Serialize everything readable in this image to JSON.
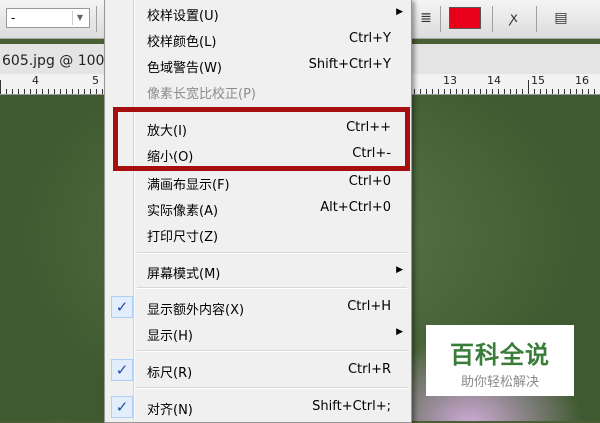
{
  "toolbar": {
    "select_value": "-",
    "swatch_color": "#e8001a"
  },
  "document": {
    "tab_label": "605.jpg @ 100"
  },
  "ruler": {
    "numbers": [
      "4",
      "5",
      "13",
      "14",
      "15",
      "16"
    ]
  },
  "menu": {
    "items": [
      {
        "label": "校样设置(U)",
        "shortcut": "",
        "submenu": true
      },
      {
        "label": "校样颜色(L)",
        "shortcut": "Ctrl+Y"
      },
      {
        "label": "色域警告(W)",
        "shortcut": "Shift+Ctrl+Y"
      },
      {
        "label": "像素长宽比校正(P)",
        "shortcut": "",
        "disabled": true
      },
      {
        "label": "放大(I)",
        "shortcut": "Ctrl++"
      },
      {
        "label": "缩小(O)",
        "shortcut": "Ctrl+-"
      },
      {
        "label": "满画布显示(F)",
        "shortcut": "Ctrl+0"
      },
      {
        "label": "实际像素(A)",
        "shortcut": "Alt+Ctrl+0"
      },
      {
        "label": "打印尺寸(Z)",
        "shortcut": ""
      },
      {
        "label": "屏幕模式(M)",
        "shortcut": "",
        "submenu": true
      },
      {
        "label": "显示额外内容(X)",
        "shortcut": "Ctrl+H",
        "checked": true
      },
      {
        "label": "显示(H)",
        "shortcut": "",
        "submenu": true
      },
      {
        "label": "标尺(R)",
        "shortcut": "Ctrl+R",
        "checked": true
      },
      {
        "label": "对齐(N)",
        "shortcut": "Shift+Ctrl+;",
        "checked": true
      }
    ],
    "highlight_color": "#a50f0f"
  },
  "watermark": {
    "title": "百科全说",
    "subtitle": "助你轻松解决"
  }
}
